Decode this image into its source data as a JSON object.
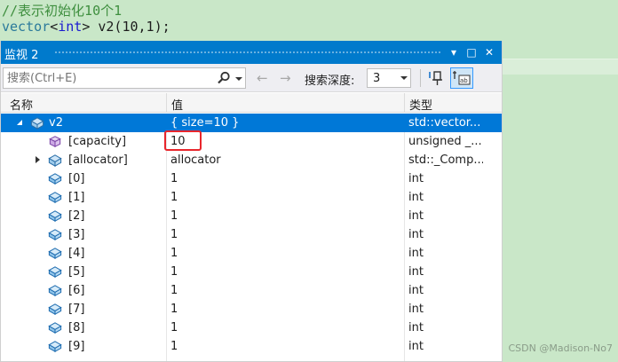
{
  "editor": {
    "comment_line": "//表示初始化10个1",
    "code": {
      "kw_vector": "vector",
      "lt": "<",
      "kw_int": "int",
      "rest": "> v2(10,1);"
    }
  },
  "watch": {
    "title": "监视 2",
    "title_buttons": {
      "dropdown": "▾",
      "maximize": "□",
      "close": "✕"
    },
    "search": {
      "placeholder": "搜索(Ctrl+E)",
      "value": ""
    },
    "nav": {
      "back": "←",
      "forward": "→"
    },
    "depth": {
      "label": "搜索深度:",
      "value": "3"
    },
    "columns": {
      "name": "名称",
      "value": "值",
      "type": "类型"
    },
    "rows": [
      {
        "name": "v2",
        "value": "{ size=10 }",
        "type": "std::vector...",
        "icon": "object-icon",
        "expander": "expanded",
        "selected": true
      },
      {
        "name": "[capacity]",
        "value": "10",
        "type": "unsigned _...",
        "icon": "purple-cube-icon",
        "expander": "none",
        "selected": false
      },
      {
        "name": "[allocator]",
        "value": "allocator",
        "type": "std::_Comp...",
        "icon": "object-icon",
        "expander": "collapsed",
        "selected": false
      },
      {
        "name": "[0]",
        "value": "1",
        "type": "int",
        "icon": "field-icon",
        "expander": "none",
        "selected": false
      },
      {
        "name": "[1]",
        "value": "1",
        "type": "int",
        "icon": "field-icon",
        "expander": "none",
        "selected": false
      },
      {
        "name": "[2]",
        "value": "1",
        "type": "int",
        "icon": "field-icon",
        "expander": "none",
        "selected": false
      },
      {
        "name": "[3]",
        "value": "1",
        "type": "int",
        "icon": "field-icon",
        "expander": "none",
        "selected": false
      },
      {
        "name": "[4]",
        "value": "1",
        "type": "int",
        "icon": "field-icon",
        "expander": "none",
        "selected": false
      },
      {
        "name": "[5]",
        "value": "1",
        "type": "int",
        "icon": "field-icon",
        "expander": "none",
        "selected": false
      },
      {
        "name": "[6]",
        "value": "1",
        "type": "int",
        "icon": "field-icon",
        "expander": "none",
        "selected": false
      },
      {
        "name": "[7]",
        "value": "1",
        "type": "int",
        "icon": "field-icon",
        "expander": "none",
        "selected": false
      },
      {
        "name": "[8]",
        "value": "1",
        "type": "int",
        "icon": "field-icon",
        "expander": "none",
        "selected": false
      },
      {
        "name": "[9]",
        "value": "1",
        "type": "int",
        "icon": "field-icon",
        "expander": "none",
        "selected": false
      }
    ]
  },
  "watermark": "CSDN @Madison-No7",
  "colors": {
    "accent": "#007acc",
    "selection": "#0078d7",
    "editor_bg": "#c9e7c8",
    "highlight_box": "#e8262c"
  }
}
